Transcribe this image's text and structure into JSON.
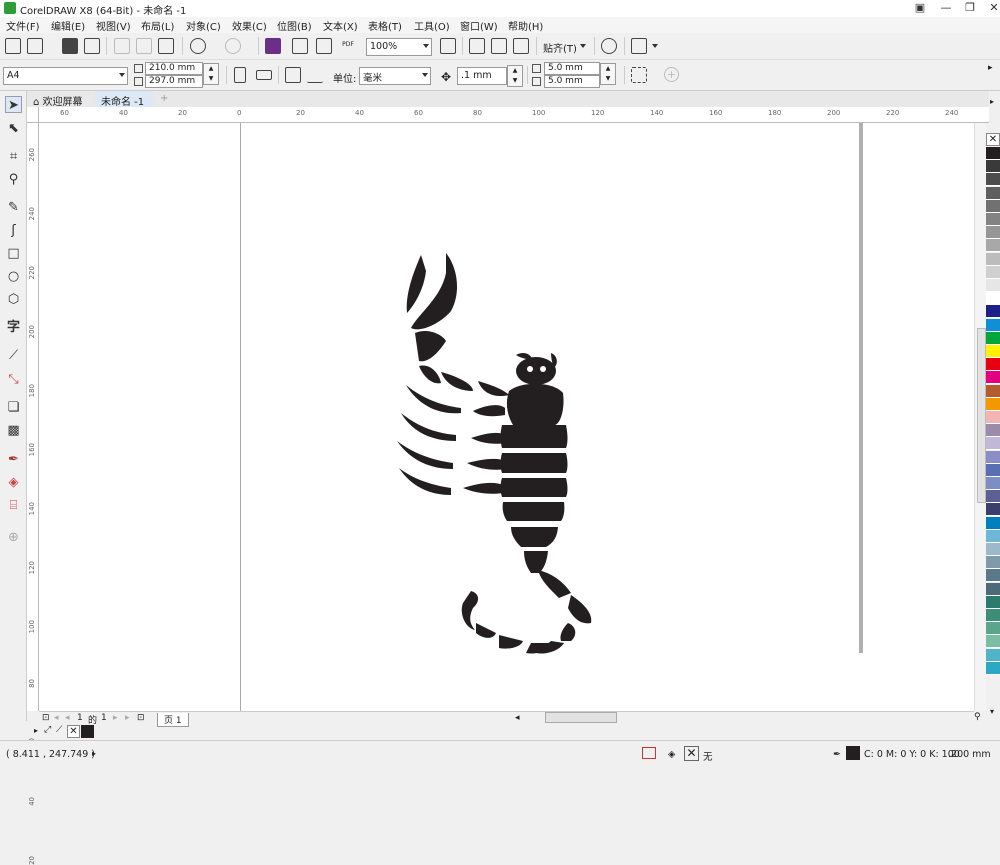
{
  "window": {
    "title": "CorelDRAW X8 (64-Bit) - 未命名 -1"
  },
  "menu": [
    "文件(F)",
    "编辑(E)",
    "视图(V)",
    "布局(L)",
    "对象(C)",
    "效果(C)",
    "位图(B)",
    "文本(X)",
    "表格(T)",
    "工具(O)",
    "窗口(W)",
    "帮助(H)"
  ],
  "toolbar": {
    "zoom": "100%",
    "snap_label": "贴齐(T)"
  },
  "propertybar": {
    "page_size": "A4",
    "width": "210.0 mm",
    "height": "297.0 mm",
    "units_label": "单位:",
    "units": "毫米",
    "nudge": ".1 mm",
    "dup_x": "5.0 mm",
    "dup_y": "5.0 mm"
  },
  "tabs": {
    "welcome": "欢迎屏幕",
    "document": "未命名 -1"
  },
  "ruler": {
    "h_labels": [
      "60",
      "40",
      "20",
      "0",
      "20",
      "40",
      "60",
      "80",
      "100",
      "120",
      "140",
      "160",
      "180",
      "200",
      "220",
      "240"
    ],
    "v_labels": [
      "260",
      "240",
      "220",
      "200",
      "180",
      "160",
      "140",
      "120",
      "100",
      "80",
      "60",
      "40",
      "20"
    ]
  },
  "pager": {
    "current": "1",
    "of": "的",
    "total": "1",
    "page_tab": "页 1"
  },
  "status": {
    "coords": "( 8.411 , 247.749 )",
    "fill_none": "无",
    "outline": "C: 0 M: 0 Y: 0 K: 100",
    "outline_width": ".200 mm"
  },
  "palette_colors": [
    "#231f20",
    "#3a3a3a",
    "#4d4d4d",
    "#5f5f5f",
    "#717171",
    "#838383",
    "#969696",
    "#a8a8a8",
    "#bcbcbc",
    "#d0d0d0",
    "#e6e6e6",
    "#ffffff",
    "#1d2088",
    "#0e8fd6",
    "#00a63c",
    "#fff200",
    "#e60012",
    "#e4007f",
    "#b35c2e",
    "#f39800",
    "#f4b4b4",
    "#9b8aa8",
    "#c1b7d8",
    "#8a8ec5",
    "#5a6fb1",
    "#7c8fc4",
    "#5c5f91",
    "#3a3f6e",
    "#007fbf",
    "#6fb7d7",
    "#9cb9cc",
    "#7f9aaa",
    "#5a7a8c",
    "#4c6a7a",
    "#2d7a6e",
    "#3c8f76",
    "#5aa58c",
    "#7cbea4",
    "#4fb4c8",
    "#2aa8c4"
  ]
}
